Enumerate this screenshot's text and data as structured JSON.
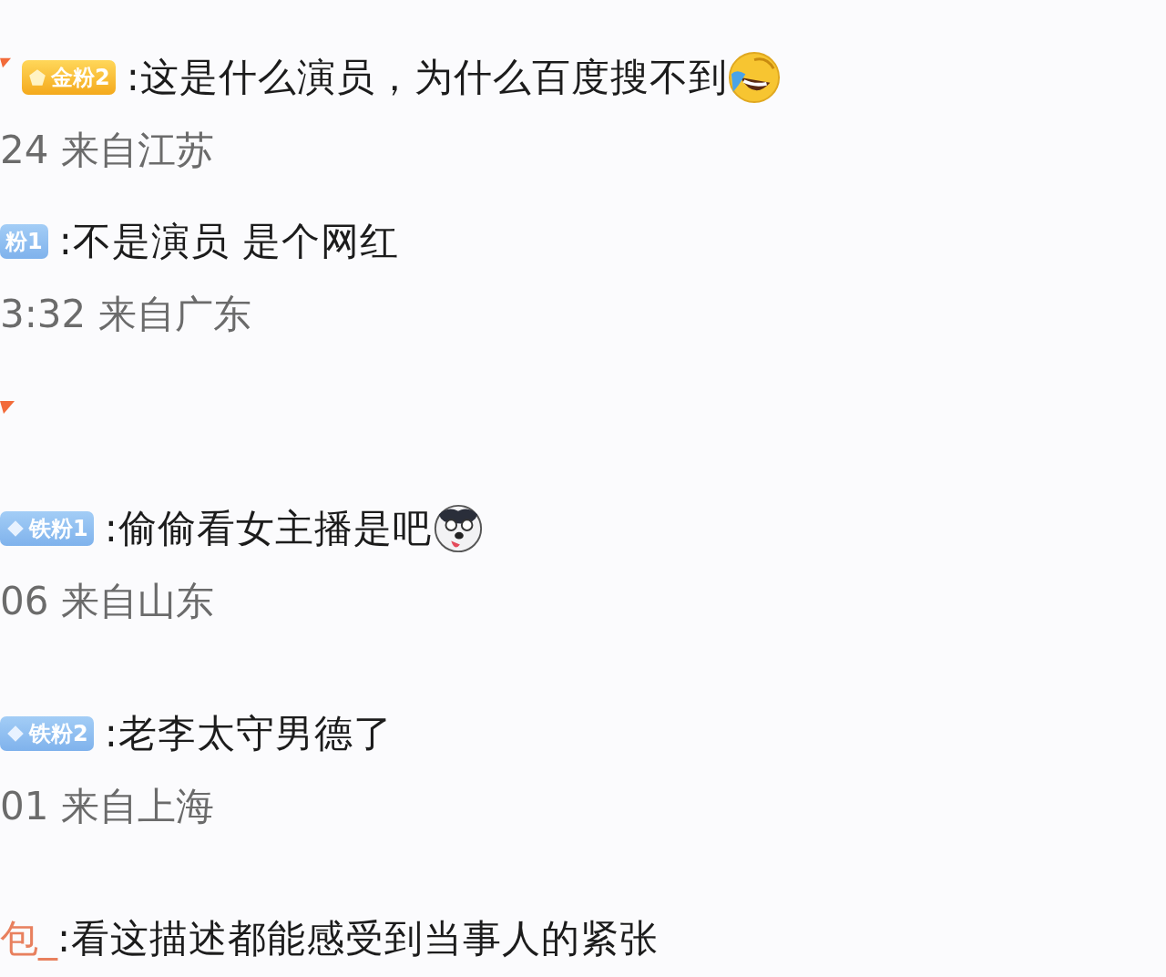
{
  "comments": [
    {
      "vip_mark": true,
      "badge": {
        "kind": "gold",
        "label": "金粉2"
      },
      "text": ":这是什么演员，为什么百度搜不到",
      "emoji": {
        "kind": "laughing"
      },
      "meta": "24 来自江苏"
    },
    {
      "badge": {
        "kind": "plain",
        "label": "粉1"
      },
      "text": ":不是演员 是个网红",
      "meta": "3:32 来自广东"
    },
    {
      "user_line": {
        "vip_mark": true
      },
      "badge": {
        "kind": "iron",
        "label": "铁粉1"
      },
      "text": ":偷偷看女主播是吧",
      "emoji": {
        "kind": "dog"
      },
      "meta": "06 来自山东"
    },
    {
      "badge": {
        "kind": "iron",
        "label": "铁粉2"
      },
      "text": ":老李太守男德了",
      "meta": "01 来自上海"
    },
    {
      "username": "包_",
      "text": ":看这描述都能感受到当事人的紧张"
    }
  ]
}
